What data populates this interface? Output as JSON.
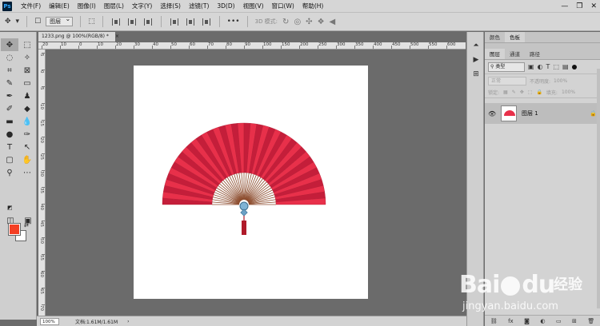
{
  "app": {
    "logo": "Ps"
  },
  "menu": [
    "文件(F)",
    "编辑(E)",
    "图像(I)",
    "图层(L)",
    "文字(Y)",
    "选择(S)",
    "滤镜(T)",
    "3D(D)",
    "视图(V)",
    "窗口(W)",
    "帮助(H)"
  ],
  "options_bar": {
    "auto_select_value": "图层",
    "mode_3d_label": "3D 模式:"
  },
  "document": {
    "tab_title": "1233.png @ 100%(RGB/8) *",
    "close_glyph": "×"
  },
  "ruler_h_labels": [
    "20",
    "10",
    "0",
    "10",
    "20",
    "30",
    "40",
    "50",
    "60",
    "70",
    "80",
    "90",
    "100",
    "150",
    "200",
    "250",
    "300",
    "350",
    "400",
    "450",
    "500",
    "550",
    "600"
  ],
  "ruler_v_labels": [
    "5",
    "0",
    "5",
    "10",
    "15",
    "20",
    "25",
    "30",
    "35",
    "40",
    "45",
    "50",
    "55",
    "60",
    "65",
    "70"
  ],
  "status": {
    "zoom": "100%",
    "doc_info": "文档:1.61M/1.61M",
    "arrow": "›"
  },
  "panels": {
    "top_tabs": [
      "颜色",
      "色板"
    ],
    "layer_tabs": [
      "图层",
      "通道",
      "路径"
    ],
    "filter_label": "类型",
    "blend_mode": "正常",
    "opacity_label": "不透明度:",
    "opacity_value": "100%",
    "lock_label": "锁定:",
    "fill_label": "填充:",
    "fill_value": "100%",
    "layer_name": "图层 1"
  },
  "watermark": {
    "brand_left": "Bai",
    "brand_right": "du",
    "cn": "经验",
    "url": "jingyan.baidu.com"
  },
  "colors": {
    "foreground": "#f43f24",
    "background": "#ffffff",
    "fan_red": "#e8304a",
    "fan_stripe": "#c41e3a",
    "fan_rib": "#8b4a2b",
    "tassel": "#b01a2a"
  }
}
